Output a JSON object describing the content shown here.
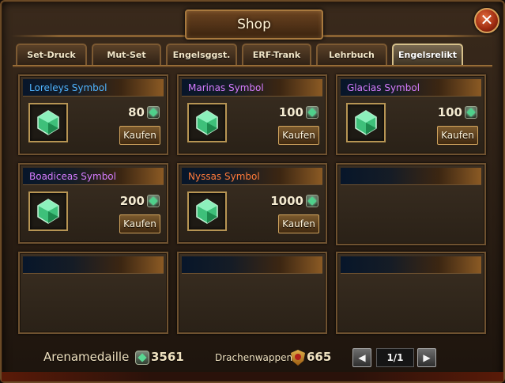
{
  "window": {
    "title": "Shop",
    "close_symbol": "✕"
  },
  "tabs": [
    {
      "label": "Set-Druck",
      "active": false
    },
    {
      "label": "Mut-Set",
      "active": false
    },
    {
      "label": "Engelsggst.",
      "active": false
    },
    {
      "label": "ERF-Trank",
      "active": false
    },
    {
      "label": "Lehrbuch",
      "active": false
    },
    {
      "label": "Engelsrelikt",
      "active": true
    }
  ],
  "items": [
    {
      "name": "Loreleys Symbol",
      "name_color": "#4fb4ff",
      "price": "80",
      "buy_label": "Kaufen",
      "icon": "green-gem-icon",
      "currency_icon": "arena-medal-icon"
    },
    {
      "name": "Marinas Symbol",
      "name_color": "#d67cff",
      "price": "100",
      "buy_label": "Kaufen",
      "icon": "green-gem-icon",
      "currency_icon": "arena-medal-icon"
    },
    {
      "name": "Glacias Symbol",
      "name_color": "#d67cff",
      "price": "100",
      "buy_label": "Kaufen",
      "icon": "green-gem-icon",
      "currency_icon": "arena-medal-icon"
    },
    {
      "name": "Boadiceas Symbol",
      "name_color": "#d67cff",
      "price": "200",
      "buy_label": "Kaufen",
      "icon": "green-gem-icon",
      "currency_icon": "arena-medal-icon"
    },
    {
      "name": "Nyssas Symbol",
      "name_color": "#ff7a3a",
      "price": "1000",
      "buy_label": "Kaufen",
      "icon": "green-gem-icon",
      "currency_icon": "arena-medal-icon"
    }
  ],
  "footer": {
    "arena_label": "Arenamedaille",
    "arena_value": "3561",
    "crest_label": "Drachenwappen",
    "crest_value": "665",
    "page": "1/1",
    "prev_symbol": "◀",
    "next_symbol": "▶"
  }
}
